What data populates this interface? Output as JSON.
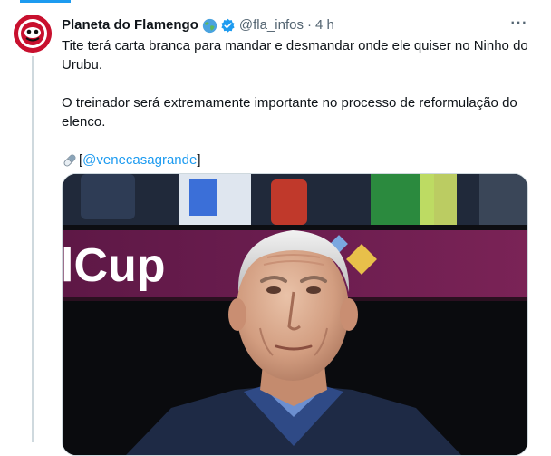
{
  "tweet": {
    "display_name": "Planeta do Flamengo",
    "handle": "@fla_infos",
    "separator": "·",
    "time": "4 h",
    "more_label": "···",
    "paragraph_1": "Tite terá carta branca para mandar e desmandar onde ele quiser no Ninho do Urubu.",
    "paragraph_2": "O treinador será extremamente importante no processo de reformulação do elenco.",
    "bracket_open": "[",
    "mention": "@venecasagrande",
    "bracket_close": "]",
    "photo_banner_text": "lCup"
  },
  "icons": {
    "avatar": "flamengo-logo-icon",
    "globe": "globe-icon",
    "verified": "verified-badge-icon",
    "more": "more-options-icon",
    "pill": "pill-icon"
  },
  "colors": {
    "accent": "#1d9bf0",
    "flamengo_red": "#c8102e",
    "verified_blue": "#1d9bf0",
    "banner_purple": "#6b1d4f"
  }
}
